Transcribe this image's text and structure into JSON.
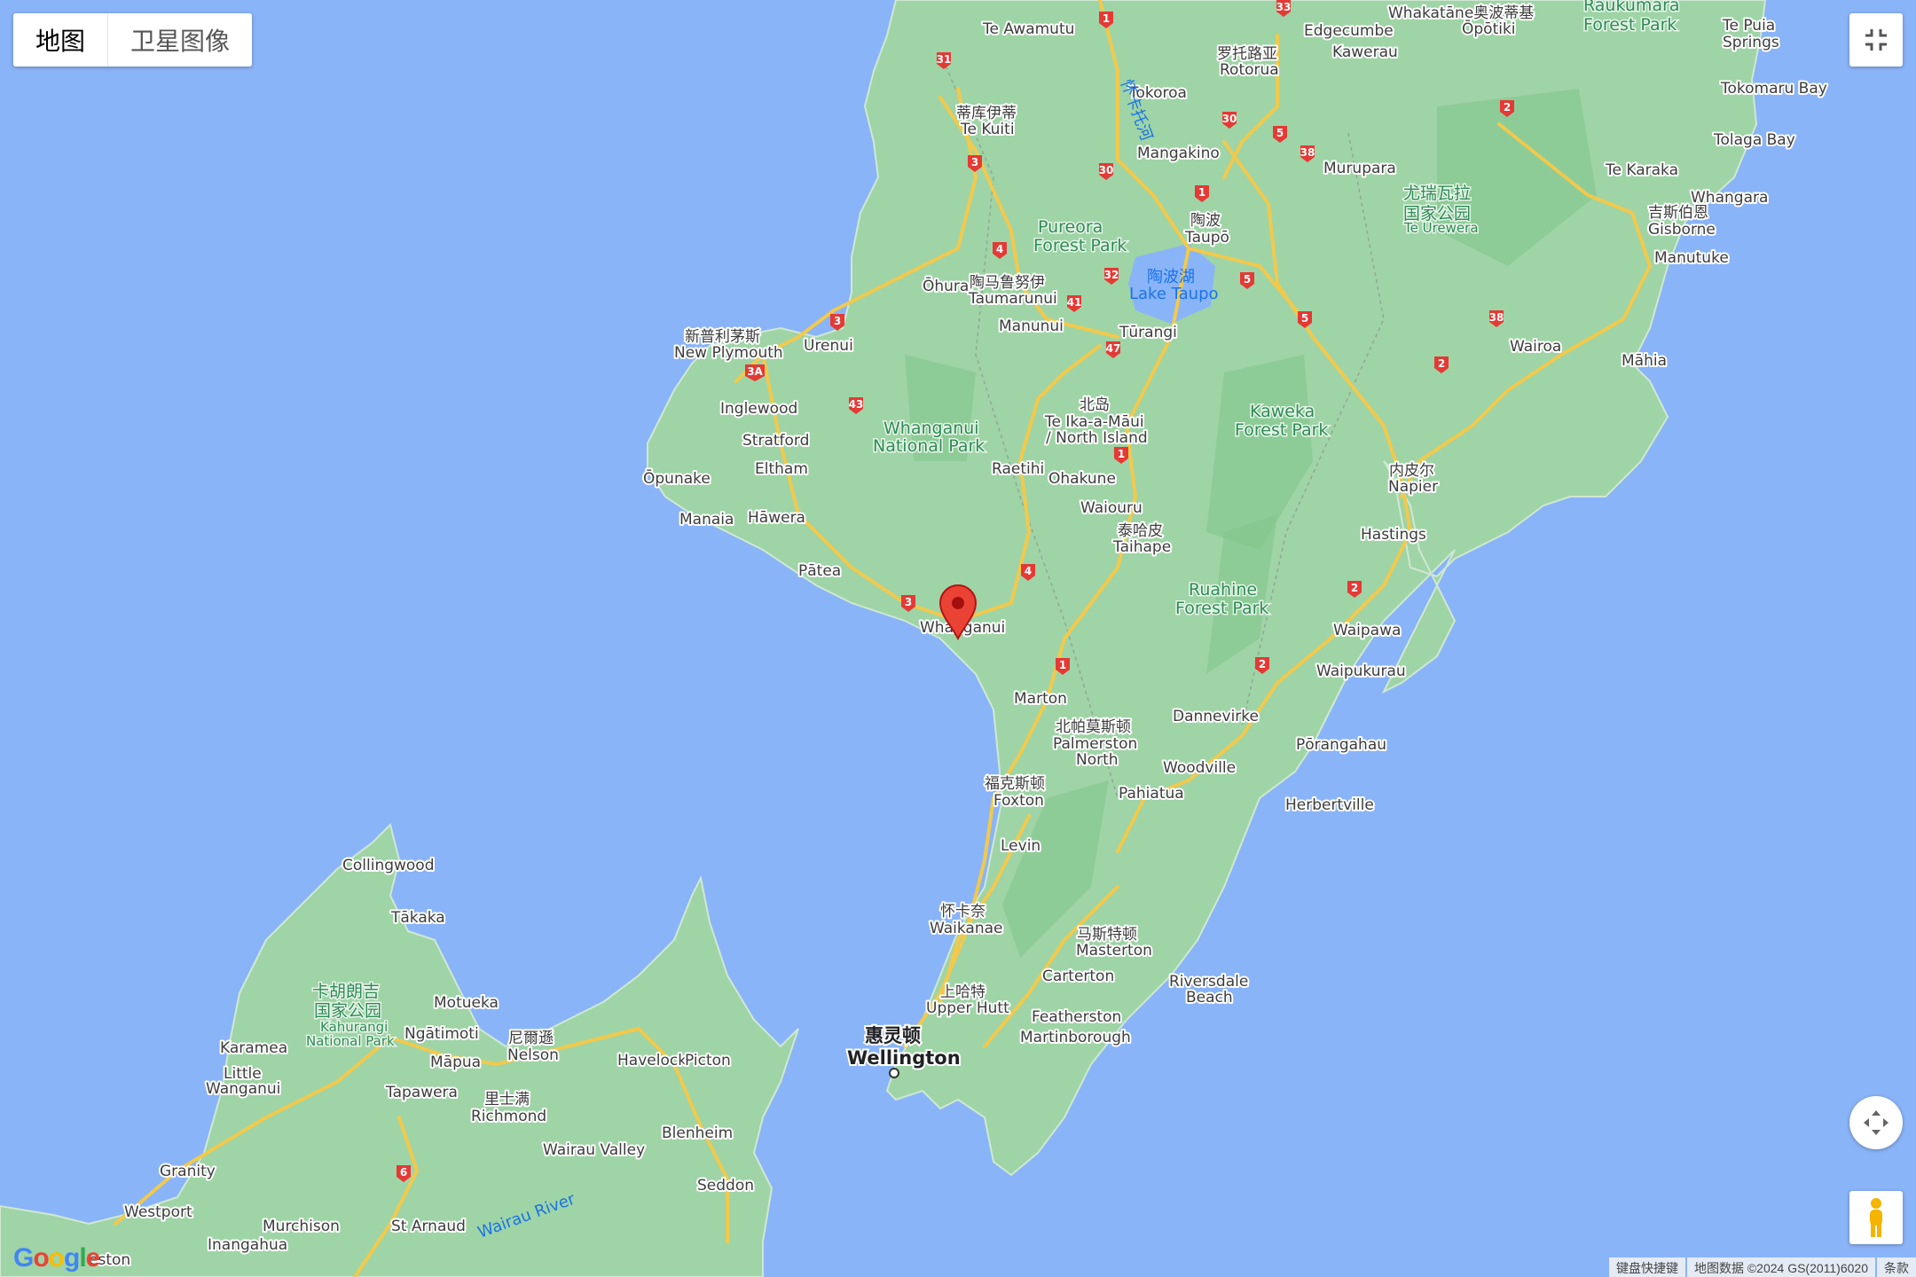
{
  "map_type_control": {
    "map_label": "地图",
    "satellite_label": "卫星图像"
  },
  "footer": {
    "shortcuts": "键盘快捷键",
    "map_data": "地图数据 ©2024 GS(2011)6020",
    "terms": "条款"
  },
  "logo": {
    "text": "Google"
  },
  "colors": {
    "water": "#8ab4f8",
    "land": "#9fd4a6",
    "road": "#f2c94c",
    "marker": "#ea4335"
  },
  "icons": {
    "fullscreen": "fullscreen-exit-icon",
    "camera": "camera-control-icon",
    "pegman": "pegman-icon",
    "marker": "location-pin-icon"
  },
  "labels": {
    "te_awamutu": "Te Awamutu",
    "edgecumbe": "Edgecumbe",
    "whakatane": "Whakatāne奥波蒂基",
    "opotiki": "Ōpōtiki",
    "raukumara1": "Raukumara",
    "raukumara2": "Forest Park",
    "te_puia1": "Te Puia",
    "te_puia2": "Springs",
    "rotorua_cn": "罗托路亚",
    "rotorua": "Rotorua",
    "kawerau": "Kawerau",
    "tokoroa": "Tokoroa",
    "tekuiti_cn": "蒂库伊蒂",
    "tekuiti": "Te Kuiti",
    "river_waikato": "怀卡托河",
    "tokomaru": "Tokomaru Bay",
    "tolaga": "Tolaga Bay",
    "mangakino": "Mangakino",
    "murupara": "Murupara",
    "te_karaka": "Te Karaka",
    "whangara": "Whangara",
    "gisborne_cn": "吉斯伯恩",
    "gisborne": "Gisborne",
    "manutuke": "Manutuke",
    "taupo_cn": "陶波",
    "taupo": "Taupō",
    "urewera_cn1": "尤瑞瓦拉",
    "urewera_cn2": "国家公园",
    "urewera": "Te Urewera",
    "pureora1": "Pureora",
    "pureora2": "Forest Park",
    "lake_taupo_cn": "陶波湖",
    "lake_taupo": "Lake Taupo",
    "ohura": "Ōhura",
    "taumarunui_cn": "陶马鲁努伊",
    "taumarunui": "Taumarunui",
    "manunui": "Manunui",
    "turangi": "Tūrangi",
    "wairoa": "Wairoa",
    "mahia": "Māhia",
    "np_cn": "新普利茅斯",
    "np": "New Plymouth",
    "urenui": "Urenui",
    "inglewood": "Inglewood",
    "whanganui_np1": "Whanganui",
    "whanganui_np2": "National Park",
    "north_island_cn": "北岛",
    "north_island1": "Te Ika-a-Māui",
    "north_island2": "/ North Island",
    "kaweka1": "Kaweka",
    "kaweka2": "Forest Park",
    "stratford": "Stratford",
    "eltham": "Eltham",
    "opunake": "Ōpunake",
    "raetihi": "Raetihi",
    "ohakune": "Ohakune",
    "napier_cn": "内皮尔",
    "napier": "Napier",
    "waiouru": "Waiouru",
    "manaia": "Manaia",
    "hawera": "Hāwera",
    "taihape_cn": "泰哈皮",
    "taihape": "Taihape",
    "hastings": "Hastings",
    "patea": "Pātea",
    "ruahine1": "Ruahine",
    "ruahine2": "Forest Park",
    "whanganui": "Whanganui",
    "waipawa": "Waipawa",
    "waipukurau": "Waipukurau",
    "marton": "Marton",
    "dannevirke": "Dannevirke",
    "pn_cn": "北帕莫斯顿",
    "pn1": "Palmerston",
    "pn2": "North",
    "porangahau": "Pōrangahau",
    "foxton_cn": "福克斯顿",
    "foxton": "Foxton",
    "woodville": "Woodville",
    "pahiatua": "Pahiatua",
    "herbertville": "Herbertville",
    "levin": "Levin",
    "collingwood": "Collingwood",
    "takaka": "Tākaka",
    "waikanae_cn": "怀卡奈",
    "waikanae": "Waikanae",
    "masterton_cn": "马斯特顿",
    "masterton": "Masterton",
    "kahurangi_cn1": "卡胡朗吉",
    "kahurangi_cn2": "国家公园",
    "kahurangi1": "Kahurangi",
    "kahurangi2": "National Park",
    "motueka": "Motueka",
    "carterton": "Carterton",
    "riversdale1": "Riversdale",
    "riversdale2": "Beach",
    "upper_hutt_cn": "上哈特",
    "upper_hutt": "Upper Hutt",
    "ngatimoti": "Ngātimoti",
    "featherston": "Featherston",
    "nelson_cn": "尼爾遜",
    "nelson": "Nelson",
    "karamea": "Karamea",
    "wellington_cn": "惠灵顿",
    "wellington": "Wellington",
    "martinborough": "Martinborough",
    "mapua": "Māpua",
    "havelock": "Havelock",
    "picton": "Picton",
    "little_wanganui1": "Little",
    "little_wanganui2": "Wanganui",
    "tapawera": "Tapawera",
    "richmond_cn": "里士满",
    "richmond": "Richmond",
    "blenheim": "Blenheim",
    "wairau_valley": "Wairau Valley",
    "granity": "Granity",
    "seddon": "Seddon",
    "wairau_river": "Wairau River",
    "westport": "Westport",
    "murchison": "Murchison",
    "st_arnaud": "St Arnaud",
    "inangahua": "Inangahua",
    "weston": "eston"
  },
  "road_shields": [
    "1",
    "33",
    "31",
    "30",
    "5",
    "38",
    "2",
    "3",
    "30",
    "1",
    "4",
    "32",
    "5",
    "41",
    "47",
    "3",
    "5",
    "38",
    "2",
    "3A",
    "43",
    "1",
    "4",
    "3",
    "2",
    "1",
    "2",
    "6"
  ]
}
